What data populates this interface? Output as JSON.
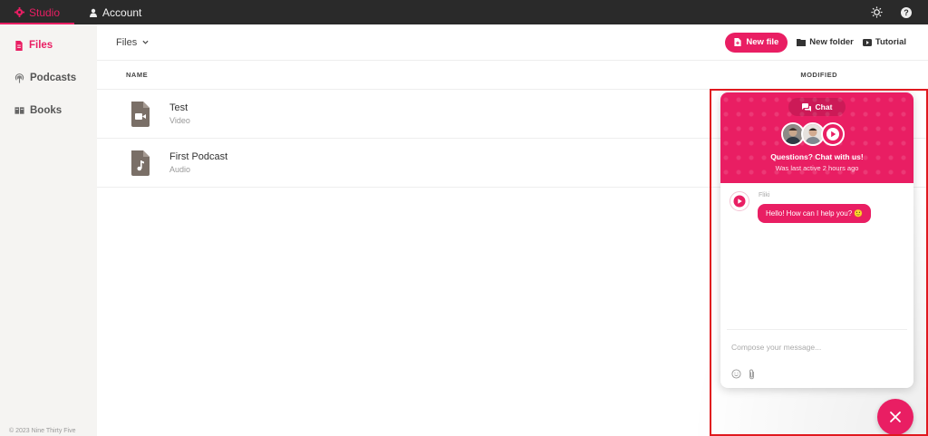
{
  "topbar": {
    "tabs": [
      {
        "label": "Studio",
        "icon": "studio-gear-icon",
        "active": true
      },
      {
        "label": "Account",
        "icon": "user-icon",
        "active": false
      }
    ],
    "right_icons": [
      "sun-icon",
      "help-icon"
    ]
  },
  "sidebar": {
    "items": [
      {
        "label": "Files",
        "icon": "file-icon",
        "active": true
      },
      {
        "label": "Podcasts",
        "icon": "podcast-icon",
        "active": false
      },
      {
        "label": "Books",
        "icon": "books-icon",
        "active": false
      }
    ],
    "copyright": "© 2023 Nine Thirty Five"
  },
  "toolbar": {
    "breadcrumb": "Files",
    "new_file": "New file",
    "new_folder": "New folder",
    "tutorial": "Tutorial"
  },
  "table": {
    "columns": [
      "NAME",
      "MODIFIED"
    ],
    "rows": [
      {
        "title": "Test",
        "type": "Video",
        "icon": "video-file-icon"
      },
      {
        "title": "First Podcast",
        "type": "Audio",
        "icon": "audio-file-icon"
      }
    ]
  },
  "chat": {
    "tab_label": "Chat",
    "title": "Questions? Chat with us!",
    "status": "Was last active 2 hours ago",
    "sender": "Fliki",
    "message": "Hello! How can I help you? 🙂",
    "compose_placeholder": "Compose your message..."
  },
  "colors": {
    "accent": "#e91e63",
    "topbar": "#2a2a2a",
    "sidebar": "#f5f4f2",
    "highlight": "#e0191f"
  }
}
